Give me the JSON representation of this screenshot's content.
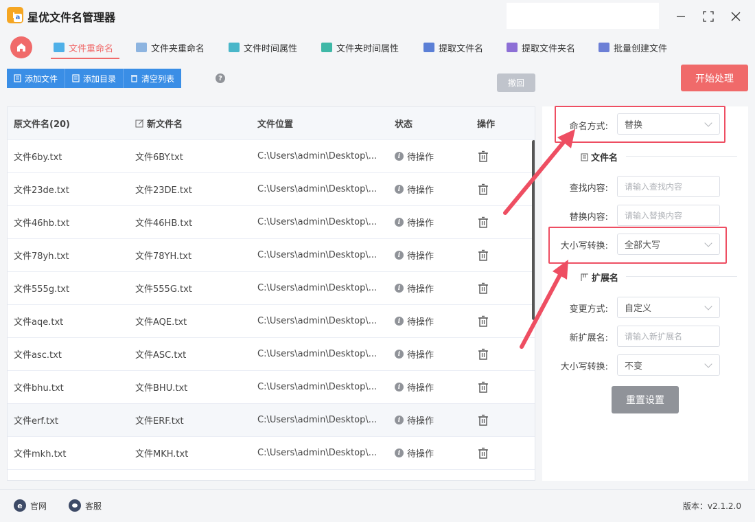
{
  "app": {
    "title": "星优文件名管理器"
  },
  "tabs": [
    {
      "label": "文件重命名",
      "active": true,
      "icon": "rename-icon"
    },
    {
      "label": "文件夹重命名",
      "icon": "folder-rename-icon"
    },
    {
      "label": "文件时间属性",
      "icon": "file-time-icon"
    },
    {
      "label": "文件夹时间属性",
      "icon": "folder-time-icon"
    },
    {
      "label": "提取文件名",
      "icon": "extract-file-icon"
    },
    {
      "label": "提取文件夹名",
      "icon": "extract-folder-icon"
    },
    {
      "label": "批量创建文件",
      "icon": "batch-create-icon"
    }
  ],
  "toolbar": {
    "add_file": "添加文件",
    "add_dir": "添加目录",
    "clear_list": "清空列表",
    "undo": "撤回",
    "start": "开始处理"
  },
  "table": {
    "headers": {
      "orig": "原文件名(20)",
      "new": "新文件名",
      "loc": "文件位置",
      "status": "状态",
      "ops": "操作"
    },
    "rows": [
      {
        "orig": "文件6by.txt",
        "new": "文件6BY.txt",
        "loc": "C:\\Users\\admin\\Desktop\\...",
        "status": "待操作"
      },
      {
        "orig": "文件23de.txt",
        "new": "文件23DE.txt",
        "loc": "C:\\Users\\admin\\Desktop\\...",
        "status": "待操作"
      },
      {
        "orig": "文件46hb.txt",
        "new": "文件46HB.txt",
        "loc": "C:\\Users\\admin\\Desktop\\...",
        "status": "待操作"
      },
      {
        "orig": "文件78yh.txt",
        "new": "文件78YH.txt",
        "loc": "C:\\Users\\admin\\Desktop\\...",
        "status": "待操作"
      },
      {
        "orig": "文件555g.txt",
        "new": "文件555G.txt",
        "loc": "C:\\Users\\admin\\Desktop\\...",
        "status": "待操作"
      },
      {
        "orig": "文件aqe.txt",
        "new": "文件AQE.txt",
        "loc": "C:\\Users\\admin\\Desktop\\...",
        "status": "待操作"
      },
      {
        "orig": "文件asc.txt",
        "new": "文件ASC.txt",
        "loc": "C:\\Users\\admin\\Desktop\\...",
        "status": "待操作"
      },
      {
        "orig": "文件bhu.txt",
        "new": "文件BHU.txt",
        "loc": "C:\\Users\\admin\\Desktop\\...",
        "status": "待操作"
      },
      {
        "orig": "文件erf.txt",
        "new": "文件ERF.txt",
        "loc": "C:\\Users\\admin\\Desktop\\...",
        "status": "待操作"
      },
      {
        "orig": "文件mkh.txt",
        "new": "文件MKH.txt",
        "loc": "C:\\Users\\admin\\Desktop\\...",
        "status": "待操作"
      }
    ]
  },
  "panel": {
    "naming_label": "命名方式:",
    "naming_value": "替换",
    "filename_section": "文件名",
    "find_label": "查找内容:",
    "find_placeholder": "请输入查找内容",
    "replace_label": "替换内容:",
    "replace_placeholder": "请输入替换内容",
    "case_label": "大小写转换:",
    "case_value": "全部大写",
    "ext_section": "扩展名",
    "ext_mode_label": "变更方式:",
    "ext_mode_value": "自定义",
    "new_ext_label": "新扩展名:",
    "new_ext_placeholder": "请输入新扩展名",
    "ext_case_label": "大小写转换:",
    "ext_case_value": "不变",
    "reset": "重置设置"
  },
  "statusbar": {
    "website": "官网",
    "service": "客服",
    "version": "版本：v2.1.2.0"
  },
  "colors": {
    "accent": "#f06a6a",
    "primary": "#3a8ee6",
    "highlight_box": "#ee4e62"
  }
}
